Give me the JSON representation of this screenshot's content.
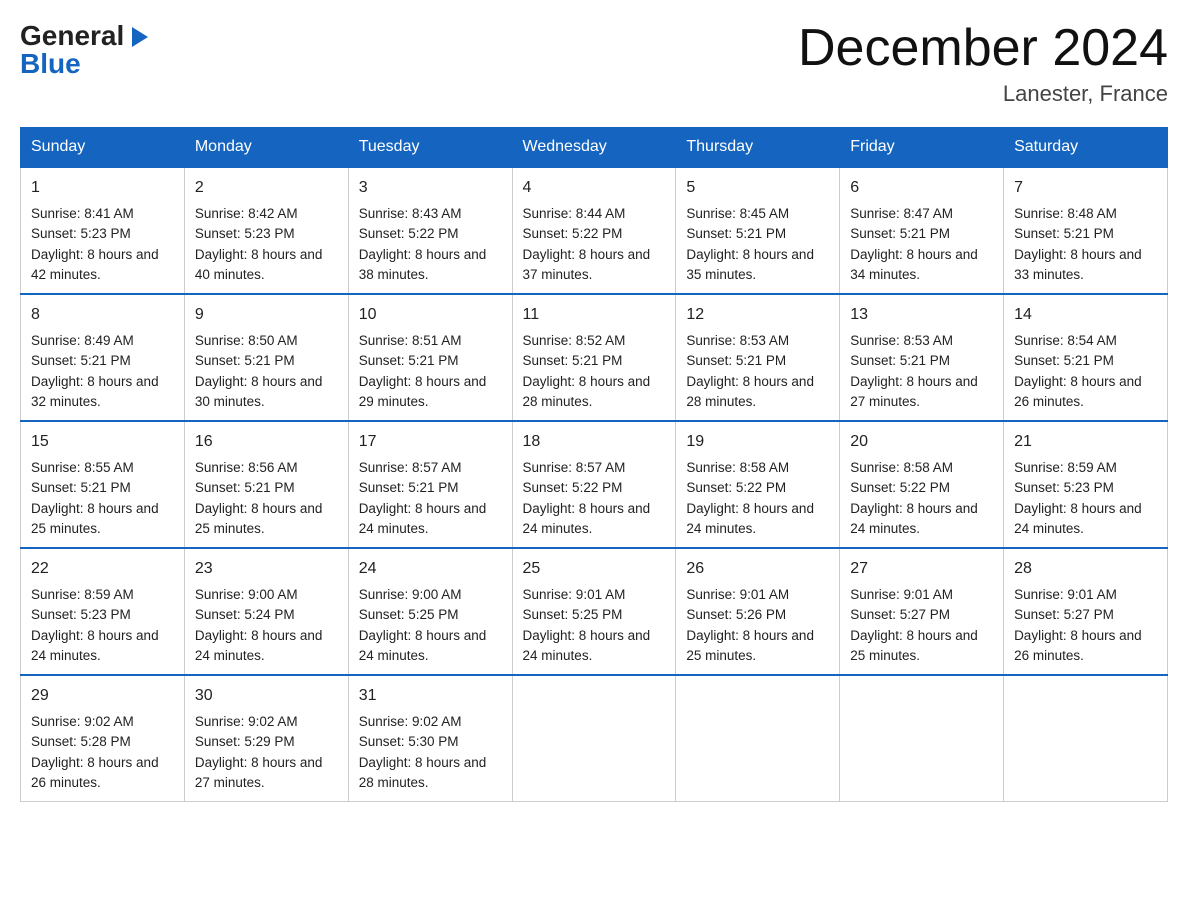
{
  "logo": {
    "line1": "General",
    "arrow": "▶",
    "line2": "Blue"
  },
  "title": "December 2024",
  "location": "Lanester, France",
  "days_of_week": [
    "Sunday",
    "Monday",
    "Tuesday",
    "Wednesday",
    "Thursday",
    "Friday",
    "Saturday"
  ],
  "weeks": [
    [
      {
        "day": "1",
        "sunrise": "8:41 AM",
        "sunset": "5:23 PM",
        "daylight": "8 hours and 42 minutes."
      },
      {
        "day": "2",
        "sunrise": "8:42 AM",
        "sunset": "5:23 PM",
        "daylight": "8 hours and 40 minutes."
      },
      {
        "day": "3",
        "sunrise": "8:43 AM",
        "sunset": "5:22 PM",
        "daylight": "8 hours and 38 minutes."
      },
      {
        "day": "4",
        "sunrise": "8:44 AM",
        "sunset": "5:22 PM",
        "daylight": "8 hours and 37 minutes."
      },
      {
        "day": "5",
        "sunrise": "8:45 AM",
        "sunset": "5:21 PM",
        "daylight": "8 hours and 35 minutes."
      },
      {
        "day": "6",
        "sunrise": "8:47 AM",
        "sunset": "5:21 PM",
        "daylight": "8 hours and 34 minutes."
      },
      {
        "day": "7",
        "sunrise": "8:48 AM",
        "sunset": "5:21 PM",
        "daylight": "8 hours and 33 minutes."
      }
    ],
    [
      {
        "day": "8",
        "sunrise": "8:49 AM",
        "sunset": "5:21 PM",
        "daylight": "8 hours and 32 minutes."
      },
      {
        "day": "9",
        "sunrise": "8:50 AM",
        "sunset": "5:21 PM",
        "daylight": "8 hours and 30 minutes."
      },
      {
        "day": "10",
        "sunrise": "8:51 AM",
        "sunset": "5:21 PM",
        "daylight": "8 hours and 29 minutes."
      },
      {
        "day": "11",
        "sunrise": "8:52 AM",
        "sunset": "5:21 PM",
        "daylight": "8 hours and 28 minutes."
      },
      {
        "day": "12",
        "sunrise": "8:53 AM",
        "sunset": "5:21 PM",
        "daylight": "8 hours and 28 minutes."
      },
      {
        "day": "13",
        "sunrise": "8:53 AM",
        "sunset": "5:21 PM",
        "daylight": "8 hours and 27 minutes."
      },
      {
        "day": "14",
        "sunrise": "8:54 AM",
        "sunset": "5:21 PM",
        "daylight": "8 hours and 26 minutes."
      }
    ],
    [
      {
        "day": "15",
        "sunrise": "8:55 AM",
        "sunset": "5:21 PM",
        "daylight": "8 hours and 25 minutes."
      },
      {
        "day": "16",
        "sunrise": "8:56 AM",
        "sunset": "5:21 PM",
        "daylight": "8 hours and 25 minutes."
      },
      {
        "day": "17",
        "sunrise": "8:57 AM",
        "sunset": "5:21 PM",
        "daylight": "8 hours and 24 minutes."
      },
      {
        "day": "18",
        "sunrise": "8:57 AM",
        "sunset": "5:22 PM",
        "daylight": "8 hours and 24 minutes."
      },
      {
        "day": "19",
        "sunrise": "8:58 AM",
        "sunset": "5:22 PM",
        "daylight": "8 hours and 24 minutes."
      },
      {
        "day": "20",
        "sunrise": "8:58 AM",
        "sunset": "5:22 PM",
        "daylight": "8 hours and 24 minutes."
      },
      {
        "day": "21",
        "sunrise": "8:59 AM",
        "sunset": "5:23 PM",
        "daylight": "8 hours and 24 minutes."
      }
    ],
    [
      {
        "day": "22",
        "sunrise": "8:59 AM",
        "sunset": "5:23 PM",
        "daylight": "8 hours and 24 minutes."
      },
      {
        "day": "23",
        "sunrise": "9:00 AM",
        "sunset": "5:24 PM",
        "daylight": "8 hours and 24 minutes."
      },
      {
        "day": "24",
        "sunrise": "9:00 AM",
        "sunset": "5:25 PM",
        "daylight": "8 hours and 24 minutes."
      },
      {
        "day": "25",
        "sunrise": "9:01 AM",
        "sunset": "5:25 PM",
        "daylight": "8 hours and 24 minutes."
      },
      {
        "day": "26",
        "sunrise": "9:01 AM",
        "sunset": "5:26 PM",
        "daylight": "8 hours and 25 minutes."
      },
      {
        "day": "27",
        "sunrise": "9:01 AM",
        "sunset": "5:27 PM",
        "daylight": "8 hours and 25 minutes."
      },
      {
        "day": "28",
        "sunrise": "9:01 AM",
        "sunset": "5:27 PM",
        "daylight": "8 hours and 26 minutes."
      }
    ],
    [
      {
        "day": "29",
        "sunrise": "9:02 AM",
        "sunset": "5:28 PM",
        "daylight": "8 hours and 26 minutes."
      },
      {
        "day": "30",
        "sunrise": "9:02 AM",
        "sunset": "5:29 PM",
        "daylight": "8 hours and 27 minutes."
      },
      {
        "day": "31",
        "sunrise": "9:02 AM",
        "sunset": "5:30 PM",
        "daylight": "8 hours and 28 minutes."
      },
      null,
      null,
      null,
      null
    ]
  ],
  "labels": {
    "sunrise_prefix": "Sunrise: ",
    "sunset_prefix": "Sunset: ",
    "daylight_prefix": "Daylight: "
  }
}
